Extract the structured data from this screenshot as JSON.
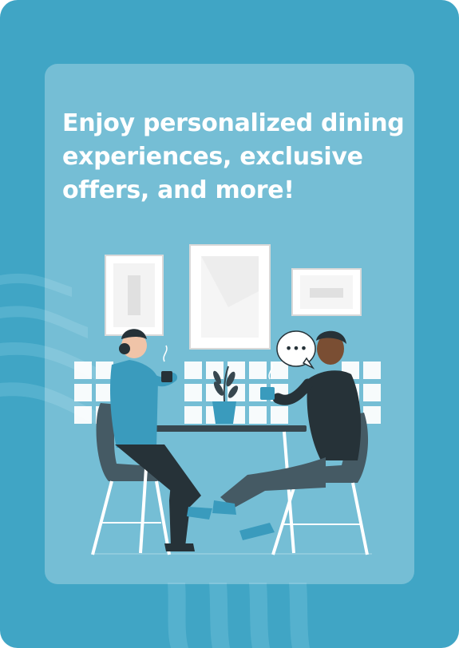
{
  "onboarding": {
    "headline": "Enjoy personalized dining experiences, exclusive offers, and more!"
  },
  "colors": {
    "background": "#40a5c5",
    "card": "rgba(255,255,255,0.28)",
    "headline": "#ffffff",
    "accent_teal": "#3a9bbd",
    "dark_clothing": "#263238"
  },
  "illustration": {
    "description_icon": "people-dining-illustration",
    "speech_bubble_text": "•••"
  }
}
